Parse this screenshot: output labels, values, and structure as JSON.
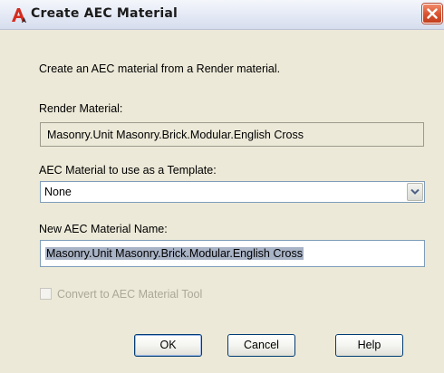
{
  "window": {
    "title": "Create AEC Material",
    "app_icon": "autocad-a-icon",
    "close_icon": "close-icon"
  },
  "dialog": {
    "description": "Create an AEC material from a Render material.",
    "render_material_label": "Render Material:",
    "render_material_value": "Masonry.Unit Masonry.Brick.Modular.English Cross",
    "template_label": "AEC Material to use as a Template:",
    "template_selected": "None",
    "new_name_label": "New AEC Material Name:",
    "new_name_value": "Masonry.Unit Masonry.Brick.Modular.English Cross",
    "convert_checkbox_label": "Convert to AEC Material Tool",
    "convert_checked": false,
    "convert_enabled": false
  },
  "buttons": {
    "ok": "OK",
    "cancel": "Cancel",
    "help": "Help"
  },
  "colors": {
    "dialog_bg": "#ece9d8",
    "close_red": "#d9512e",
    "selection_highlight": "#a9b3c6",
    "disabled_text": "#aca899"
  }
}
